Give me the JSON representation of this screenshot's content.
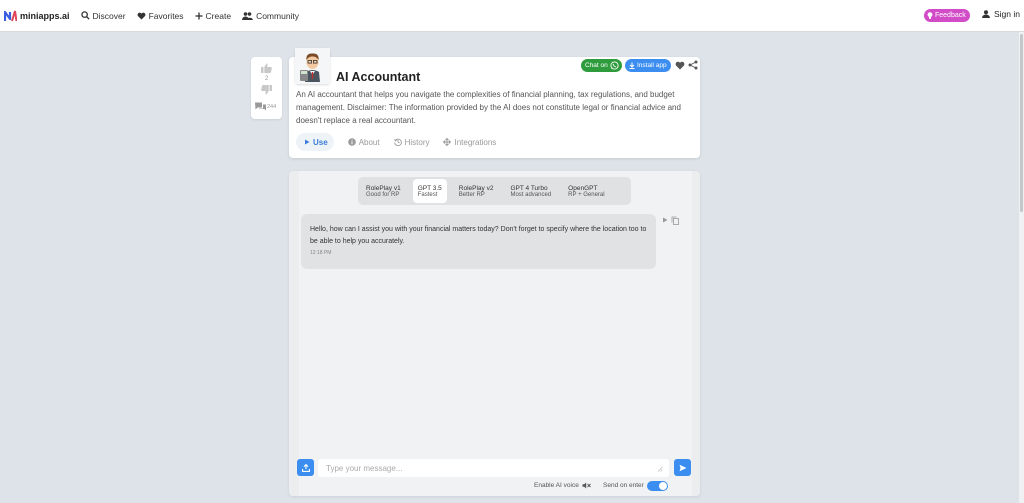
{
  "nav": {
    "brand": "miniapps.ai",
    "discover": "Discover",
    "favorites": "Favorites",
    "create": "Create",
    "community": "Community",
    "feedback": "Feedback",
    "signin": "Sign in"
  },
  "votes": {
    "upvotes": "2",
    "comments": "244"
  },
  "app": {
    "title": "AI Accountant",
    "chat_on": "Chat on",
    "install": "Install app",
    "description": "An AI accountant that helps you navigate the complexities of financial planning, tax regulations, and budget management. Disclaimer: The information provided by the AI does not constitute legal or financial advice and doesn't replace a real accountant."
  },
  "tabs": [
    {
      "label": "Use",
      "icon": "play-icon"
    },
    {
      "label": "About",
      "icon": "info-icon"
    },
    {
      "label": "History",
      "icon": "history-icon"
    },
    {
      "label": "Integrations",
      "icon": "integrations-icon"
    }
  ],
  "models": [
    {
      "name": "RolePlay v1",
      "sub": "Good for RP"
    },
    {
      "name": "GPT 3.5",
      "sub": "Fastest",
      "selected": true
    },
    {
      "name": "RolePlay v2",
      "sub": "Better RP"
    },
    {
      "name": "GPT 4 Turbo",
      "sub": "Most advanced"
    },
    {
      "name": "OpenGPT",
      "sub": "RP + General"
    }
  ],
  "message": {
    "text": "Hello, how can I assist you with your financial matters today? Don't forget to specify where the location too to be able to help you accurately.",
    "time": "12:18 PM"
  },
  "composer": {
    "placeholder": "Type your message...",
    "ai_voice": "Enable AI voice",
    "send_on_enter": "Send on enter"
  },
  "colors": {
    "accent": "#3b8ef0",
    "feedback": "#d24bc7",
    "whatsapp": "#2e9c3c"
  }
}
